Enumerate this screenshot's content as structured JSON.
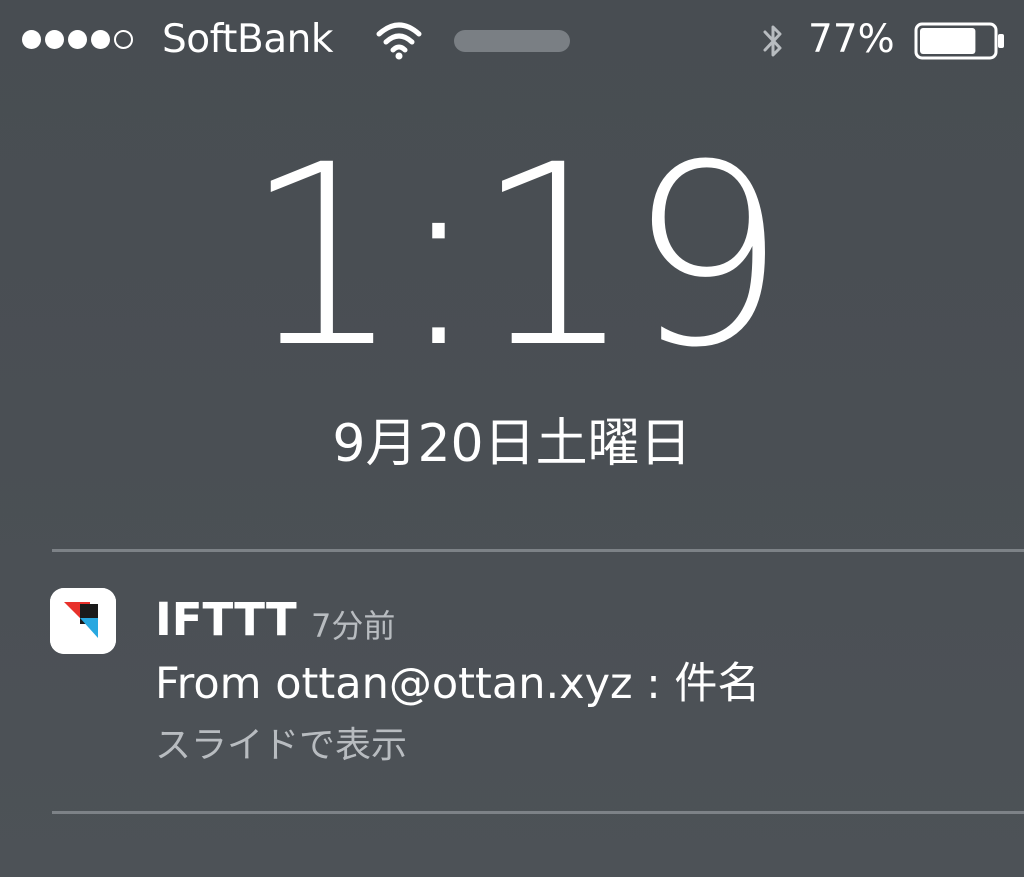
{
  "status_bar": {
    "signal_bars_filled": 4,
    "signal_bars_total": 5,
    "carrier": "SoftBank",
    "wifi_icon": "wifi-icon",
    "bluetooth_icon": "bluetooth-icon",
    "battery_percent": "77%",
    "battery_level": 0.77
  },
  "lock_screen": {
    "time": "1:19",
    "date": "9月20日土曜日"
  },
  "notification": {
    "app_icon": "ifttt-app-icon",
    "app_name": "IFTTT",
    "time_ago": "7分前",
    "message": "From ottan@ottan.xyz : 件名",
    "hint": "スライドで表示"
  },
  "colors": {
    "background": "#4a4f54",
    "text": "#ffffff",
    "secondary_text": "#b8bcc0",
    "divider": "#7d8287",
    "ifttt_red": "#e8312b",
    "ifttt_blue": "#28a8e0"
  }
}
